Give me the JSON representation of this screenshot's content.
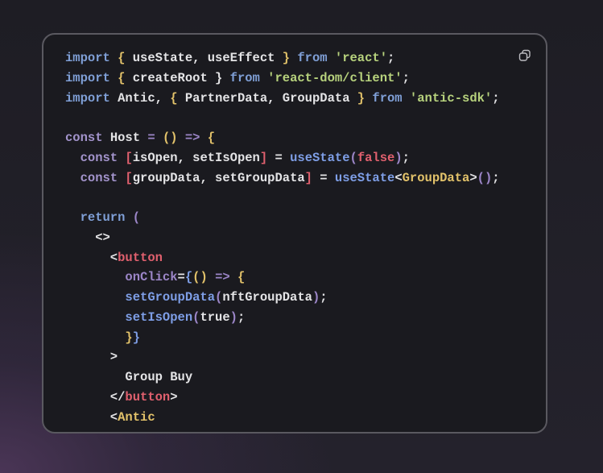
{
  "code_block": {
    "copy_icon": "copy-icon",
    "lines": [
      [
        [
          "import ",
          "kw"
        ],
        [
          "{ ",
          "br"
        ],
        [
          "useState, useEffect ",
          "tx"
        ],
        [
          "} ",
          "br"
        ],
        [
          "from ",
          "kw"
        ],
        [
          "'react'",
          "st"
        ],
        [
          ";",
          "tx"
        ]
      ],
      [
        [
          "import ",
          "kw"
        ],
        [
          "{ ",
          "br"
        ],
        [
          "createRoot } ",
          "tx"
        ],
        [
          "from ",
          "kw"
        ],
        [
          "'react-dom/client'",
          "st"
        ],
        [
          ";",
          "tx"
        ]
      ],
      [
        [
          "import ",
          "kw"
        ],
        [
          "Antic, ",
          "tx"
        ],
        [
          "{ ",
          "br"
        ],
        [
          "PartnerData, GroupData ",
          "tx"
        ],
        [
          "} ",
          "br"
        ],
        [
          "from ",
          "kw"
        ],
        [
          "'antic-sdk'",
          "st"
        ],
        [
          ";",
          "tx"
        ]
      ],
      [],
      [
        [
          "const ",
          "cn"
        ],
        [
          "Host ",
          "tx"
        ],
        [
          "= ",
          "op"
        ],
        [
          "() ",
          "br"
        ],
        [
          "=> ",
          "op"
        ],
        [
          "{",
          "br"
        ]
      ],
      [
        [
          "  const ",
          "cn"
        ],
        [
          "[",
          "rd"
        ],
        [
          "isOpen, setIsOpen",
          "tx"
        ],
        [
          "]",
          "rd"
        ],
        [
          " = ",
          "tx"
        ],
        [
          "useState",
          "fn"
        ],
        [
          "(",
          "pu"
        ],
        [
          "false",
          "rd"
        ],
        [
          ")",
          "pu"
        ],
        [
          ";",
          "tx"
        ]
      ],
      [
        [
          "  const ",
          "cn"
        ],
        [
          "[",
          "rd"
        ],
        [
          "groupData, setGroupData",
          "tx"
        ],
        [
          "]",
          "rd"
        ],
        [
          " = ",
          "tx"
        ],
        [
          "useState",
          "fn"
        ],
        [
          "<",
          "tx"
        ],
        [
          "GroupData",
          "br"
        ],
        [
          ">",
          "tx"
        ],
        [
          "()",
          "pu"
        ],
        [
          ";",
          "tx"
        ]
      ],
      [],
      [
        [
          "  return ",
          "kw"
        ],
        [
          "(",
          "pu"
        ]
      ],
      [
        [
          "    <>",
          "tx"
        ]
      ],
      [
        [
          "      <",
          "tx"
        ],
        [
          "button",
          "rd"
        ]
      ],
      [
        [
          "        onClick",
          "pu"
        ],
        [
          "=",
          "tx"
        ],
        [
          "{",
          "fn"
        ],
        [
          "() ",
          "br"
        ],
        [
          "=> ",
          "op"
        ],
        [
          "{",
          "br"
        ]
      ],
      [
        [
          "        setGroupData",
          "fn"
        ],
        [
          "(",
          "pu"
        ],
        [
          "nftGroupData",
          "tx"
        ],
        [
          ")",
          "pu"
        ],
        [
          ";",
          "tx"
        ]
      ],
      [
        [
          "        setIsOpen",
          "fn"
        ],
        [
          "(",
          "pu"
        ],
        [
          "true",
          "tx"
        ],
        [
          ")",
          "pu"
        ],
        [
          ";",
          "tx"
        ]
      ],
      [
        [
          "        }",
          "br"
        ],
        [
          "}",
          "fn"
        ]
      ],
      [
        [
          "      >",
          "tx"
        ]
      ],
      [
        [
          "        Group Buy",
          "tx"
        ]
      ],
      [
        [
          "      </",
          "tx"
        ],
        [
          "button",
          "rd"
        ],
        [
          ">",
          "tx"
        ]
      ],
      [
        [
          "      <",
          "tx"
        ],
        [
          "Antic",
          "br"
        ]
      ]
    ]
  }
}
